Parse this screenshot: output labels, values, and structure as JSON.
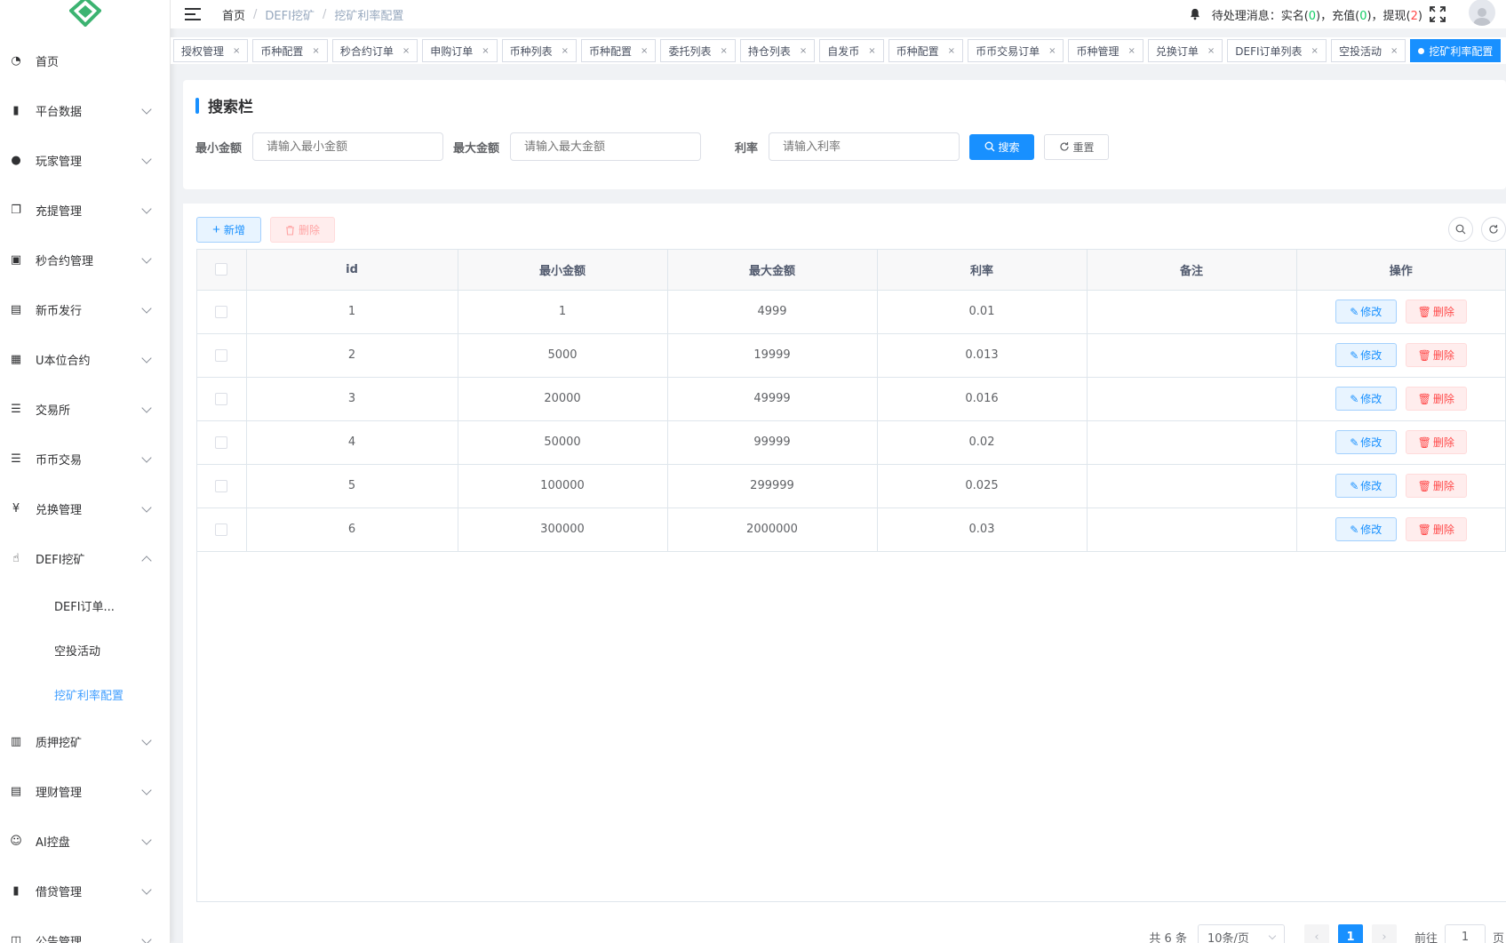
{
  "sidebar": {
    "items": [
      {
        "label": "首页",
        "icon": "dashboard-icon",
        "expandable": false
      },
      {
        "label": "平台数据",
        "icon": "book-icon",
        "expandable": true
      },
      {
        "label": "玩家管理",
        "icon": "user-icon",
        "expandable": true
      },
      {
        "label": "充提管理",
        "icon": "documents-icon",
        "expandable": true
      },
      {
        "label": "秒合约管理",
        "icon": "monitor-icon",
        "expandable": true
      },
      {
        "label": "新币发行",
        "icon": "card-icon",
        "expandable": true
      },
      {
        "label": "U本位合约",
        "icon": "table-icon",
        "expandable": true
      },
      {
        "label": "交易所",
        "icon": "tree-list-icon",
        "expandable": true
      },
      {
        "label": "币币交易",
        "icon": "list-icon",
        "expandable": true
      },
      {
        "label": "兑换管理",
        "icon": "yen-icon",
        "expandable": true
      },
      {
        "label": "DEFI挖矿",
        "icon": "pointer-icon",
        "expandable": true,
        "open": true
      },
      {
        "label": "质押挖矿",
        "icon": "chart-bars-icon",
        "expandable": true
      },
      {
        "label": "理财管理",
        "icon": "document-icon",
        "expandable": true
      },
      {
        "label": "AI控盘",
        "icon": "robot-icon",
        "expandable": true
      },
      {
        "label": "借贷管理",
        "icon": "book-icon",
        "expandable": true
      },
      {
        "label": "公告管理",
        "icon": "notice-icon",
        "expandable": true
      }
    ],
    "defi_children": [
      "DEFI订单...",
      "空投活动",
      "挖矿利率配置"
    ]
  },
  "header": {
    "breadcrumb": [
      "首页",
      "DEFI挖矿",
      "挖矿利率配置"
    ],
    "pending_label": "待处理消息：实名(",
    "realname_count": "0",
    "recharge_label": ")，充值(",
    "recharge_count": "0",
    "withdraw_label": ")，提现(",
    "withdraw_count": "2",
    "close_paren": ")"
  },
  "tabs": [
    "授权管理",
    "币种配置",
    "秒合约订单",
    "申购订单",
    "币种列表",
    "币种配置",
    "委托列表",
    "持仓列表",
    "自发币",
    "币种配置",
    "币币交易订单",
    "币种管理",
    "兑换订单",
    "DEFI订单列表",
    "空投活动",
    "挖矿利率配置"
  ],
  "search": {
    "title": "搜索栏",
    "min_label": "最小金额",
    "min_placeholder": "请输入最小金额",
    "max_label": "最大金额",
    "max_placeholder": "请输入最大金额",
    "rate_label": "利率",
    "rate_placeholder": "请输入利率",
    "search_btn": "搜索",
    "reset_btn": "重置"
  },
  "toolbar": {
    "add_label": "新增",
    "delete_label": "删除"
  },
  "table": {
    "columns": [
      "id",
      "最小金额",
      "最大金额",
      "利率",
      "备注",
      "操作"
    ],
    "rows": [
      {
        "id": "1",
        "min": "1",
        "max": "4999",
        "rate": "0.01",
        "note": ""
      },
      {
        "id": "2",
        "min": "5000",
        "max": "19999",
        "rate": "0.013",
        "note": ""
      },
      {
        "id": "3",
        "min": "20000",
        "max": "49999",
        "rate": "0.016",
        "note": ""
      },
      {
        "id": "4",
        "min": "50000",
        "max": "99999",
        "rate": "0.02",
        "note": ""
      },
      {
        "id": "5",
        "min": "100000",
        "max": "299999",
        "rate": "0.025",
        "note": ""
      },
      {
        "id": "6",
        "min": "300000",
        "max": "2000000",
        "rate": "0.03",
        "note": ""
      }
    ],
    "edit_label": "修改",
    "delete_label": "删除"
  },
  "pagination": {
    "total": "共 6 条",
    "page_size": "10条/页",
    "current": "1",
    "goto_label": "前往",
    "goto_value": "1",
    "page_suffix": "页"
  },
  "colors": {
    "primary": "#1890ff",
    "danger": "#ff4949",
    "success": "#13ce66",
    "logo": "#3cb371"
  }
}
